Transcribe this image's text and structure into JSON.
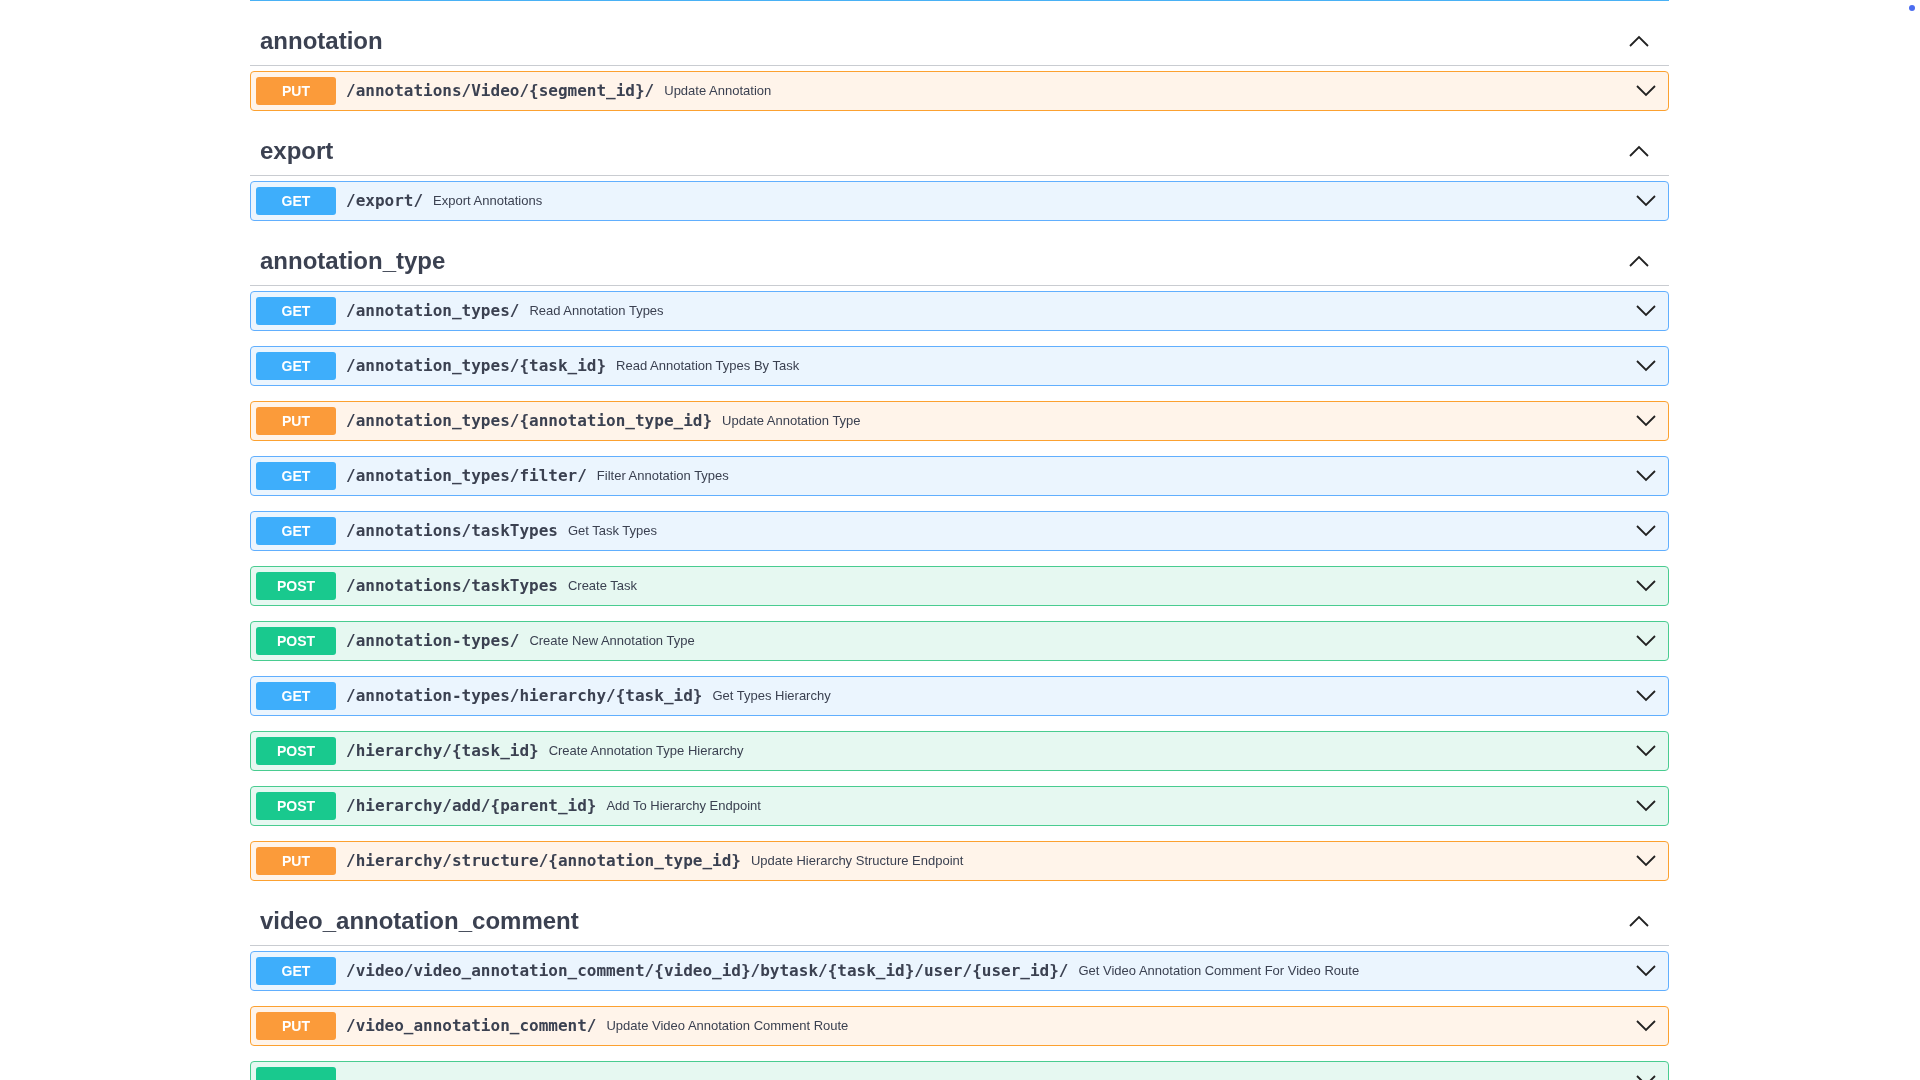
{
  "sections": [
    {
      "title": "annotation",
      "expanded": true,
      "operations": [
        {
          "kind": "put",
          "method": "PUT",
          "path": "/annotations/Video/{segment_id}/",
          "summary": "Update Annotation",
          "expanded": false
        }
      ]
    },
    {
      "title": "export",
      "expanded": true,
      "operations": [
        {
          "kind": "get",
          "method": "GET",
          "path": "/export/",
          "summary": "Export Annotations",
          "expanded": false
        }
      ]
    },
    {
      "title": "annotation_type",
      "expanded": true,
      "operations": [
        {
          "kind": "get",
          "method": "GET",
          "path": "/annotation_types/",
          "summary": "Read Annotation Types",
          "expanded": false
        },
        {
          "kind": "get",
          "method": "GET",
          "path": "/annotation_types/{task_id}",
          "summary": "Read Annotation Types By Task",
          "expanded": false
        },
        {
          "kind": "put",
          "method": "PUT",
          "path": "/annotation_types/{annotation_type_id}",
          "summary": "Update Annotation Type",
          "expanded": false
        },
        {
          "kind": "get",
          "method": "GET",
          "path": "/annotation_types/filter/",
          "summary": "Filter Annotation Types",
          "expanded": false
        },
        {
          "kind": "get",
          "method": "GET",
          "path": "/annotations/taskTypes",
          "summary": "Get Task Types",
          "expanded": false
        },
        {
          "kind": "post",
          "method": "POST",
          "path": "/annotations/taskTypes",
          "summary": "Create Task",
          "expanded": false
        },
        {
          "kind": "post",
          "method": "POST",
          "path": "/annotation-types/",
          "summary": "Create New Annotation Type",
          "expanded": false
        },
        {
          "kind": "get",
          "method": "GET",
          "path": "/annotation-types/hierarchy/{task_id}",
          "summary": "Get Types Hierarchy",
          "expanded": false
        },
        {
          "kind": "post",
          "method": "POST",
          "path": "/hierarchy/{task_id}",
          "summary": "Create Annotation Type Hierarchy",
          "expanded": false
        },
        {
          "kind": "post",
          "method": "POST",
          "path": "/hierarchy/add/{parent_id}",
          "summary": "Add To Hierarchy Endpoint",
          "expanded": false
        },
        {
          "kind": "put",
          "method": "PUT",
          "path": "/hierarchy/structure/{annotation_type_id}",
          "summary": "Update Hierarchy Structure Endpoint",
          "expanded": false
        }
      ]
    },
    {
      "title": "video_annotation_comment",
      "expanded": true,
      "operations": [
        {
          "kind": "get",
          "method": "GET",
          "path": "/video/video_annotation_comment/{video_id}/bytask/{task_id}/user/{user_id}/",
          "summary": "Get Video Annotation Comment For Video Route",
          "expanded": false
        },
        {
          "kind": "put",
          "method": "PUT",
          "path": "/video_annotation_comment/",
          "summary": "Update Video Annotation Comment Route",
          "expanded": false
        },
        {
          "kind": "post",
          "expanded": false
        }
      ]
    }
  ]
}
